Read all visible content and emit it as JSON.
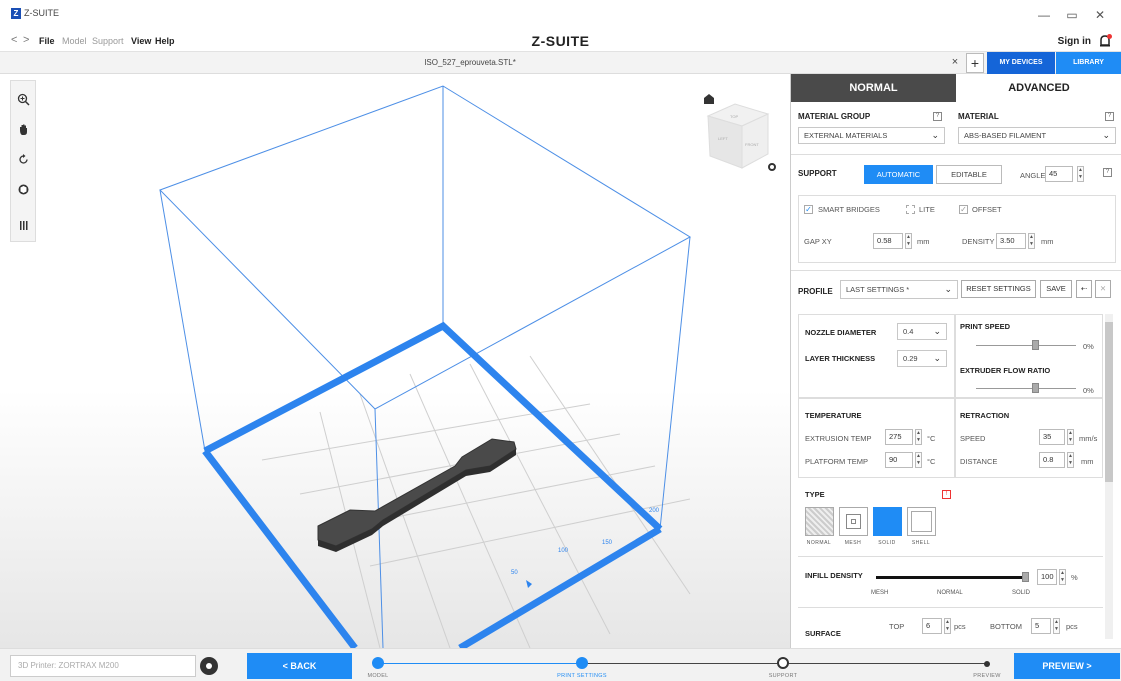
{
  "app": {
    "title": "Z-SUITE",
    "logo_letter": "Z",
    "brand": "Z-SUITE"
  },
  "window_controls": {
    "minimize": "—",
    "restore": "▭",
    "close": "✕"
  },
  "menu": {
    "back": "<",
    "forward": ">",
    "file": "File",
    "model": "Model",
    "support": "Support",
    "view": "View",
    "help": "Help",
    "sign_in": "Sign in"
  },
  "tabs": {
    "filename": "ISO_527_eprouveta.STL*",
    "close": "×",
    "add": "+",
    "my_devices": "MY DEVICES",
    "library": "LIBRARY"
  },
  "viewport": {
    "axis_labels": {
      "x_near": "50",
      "x_mid": "100",
      "x_far": "150",
      "y_far": "200",
      "axis": "x"
    },
    "view_cube": {
      "top": "TOP",
      "front": "FRONT",
      "left": "LEFT"
    },
    "model_color": "#444444",
    "grid_color": "#1f8cf5"
  },
  "panel": {
    "mode_normal": "NORMAL",
    "mode_advanced": "ADVANCED",
    "material_group_label": "MATERIAL GROUP",
    "material_group_value": "EXTERNAL MATERIALS",
    "material_label": "MATERIAL",
    "material_value": "ABS-BASED FILAMENT",
    "support_label": "SUPPORT",
    "support_automatic": "AUTOMATIC",
    "support_editable": "EDITABLE",
    "angle_label": "ANGLE",
    "angle_value": "45",
    "smart_bridges": "SMART BRIDGES",
    "lite": "LITE",
    "offset": "OFFSET",
    "gap_xy_label": "GAP XY",
    "gap_xy_value": "0.58",
    "gap_unit": "mm",
    "density_label": "DENSITY",
    "density_value": "3.50",
    "density_unit": "mm",
    "profile_label": "PROFILE",
    "profile_value": "LAST SETTINGS *",
    "reset_settings": "RESET SETTINGS",
    "save": "SAVE",
    "nozzle_label": "NOZZLE DIAMETER",
    "nozzle_value": "0.4",
    "layer_label": "LAYER THICKNESS",
    "layer_value": "0.29",
    "print_speed_label": "PRINT SPEED",
    "print_speed_unit": "0%",
    "print_speed_level": 0.6,
    "flow_label": "EXTRUDER FLOW RATIO",
    "flow_unit": "0%",
    "flow_level": 0.6,
    "temperature_label": "TEMPERATURE",
    "extrusion_temp_label": "EXTRUSION TEMP",
    "extrusion_temp_value": "275",
    "platform_temp_label": "PLATFORM TEMP",
    "platform_temp_value": "90",
    "temp_unit": "°C",
    "retraction_label": "RETRACTION",
    "speed_label": "SPEED",
    "speed_value": "35",
    "speed_unit": "mm/s",
    "distance_label": "DISTANCE",
    "distance_value": "0.8",
    "distance_unit": "mm",
    "type_label": "TYPE",
    "types": [
      "NORMAL",
      "MESH",
      "SOLID",
      "SHELL"
    ],
    "infill_label": "INFILL DENSITY",
    "infill_value": "100",
    "infill_unit": "%",
    "infill_level": 1.0,
    "infill_marks": [
      "MESH",
      "NORMAL",
      "SOLID"
    ],
    "surface_label": "SURFACE",
    "top_label": "TOP",
    "top_value": "6",
    "bottom_label": "BOTTOM",
    "bottom_value": "5",
    "pcs_unit": "pcs"
  },
  "bottom": {
    "printer_placeholder": "3D Printer: ZORTRAX M200",
    "back": "< BACK",
    "preview": "PREVIEW >",
    "steps": [
      "MODEL",
      "PRINT SETTINGS",
      "SUPPORT",
      "PREVIEW"
    ]
  },
  "colors": {
    "accent": "#1f8cf5",
    "dark_tab": "#4a4a4a",
    "device_blue": "#1565d8"
  }
}
